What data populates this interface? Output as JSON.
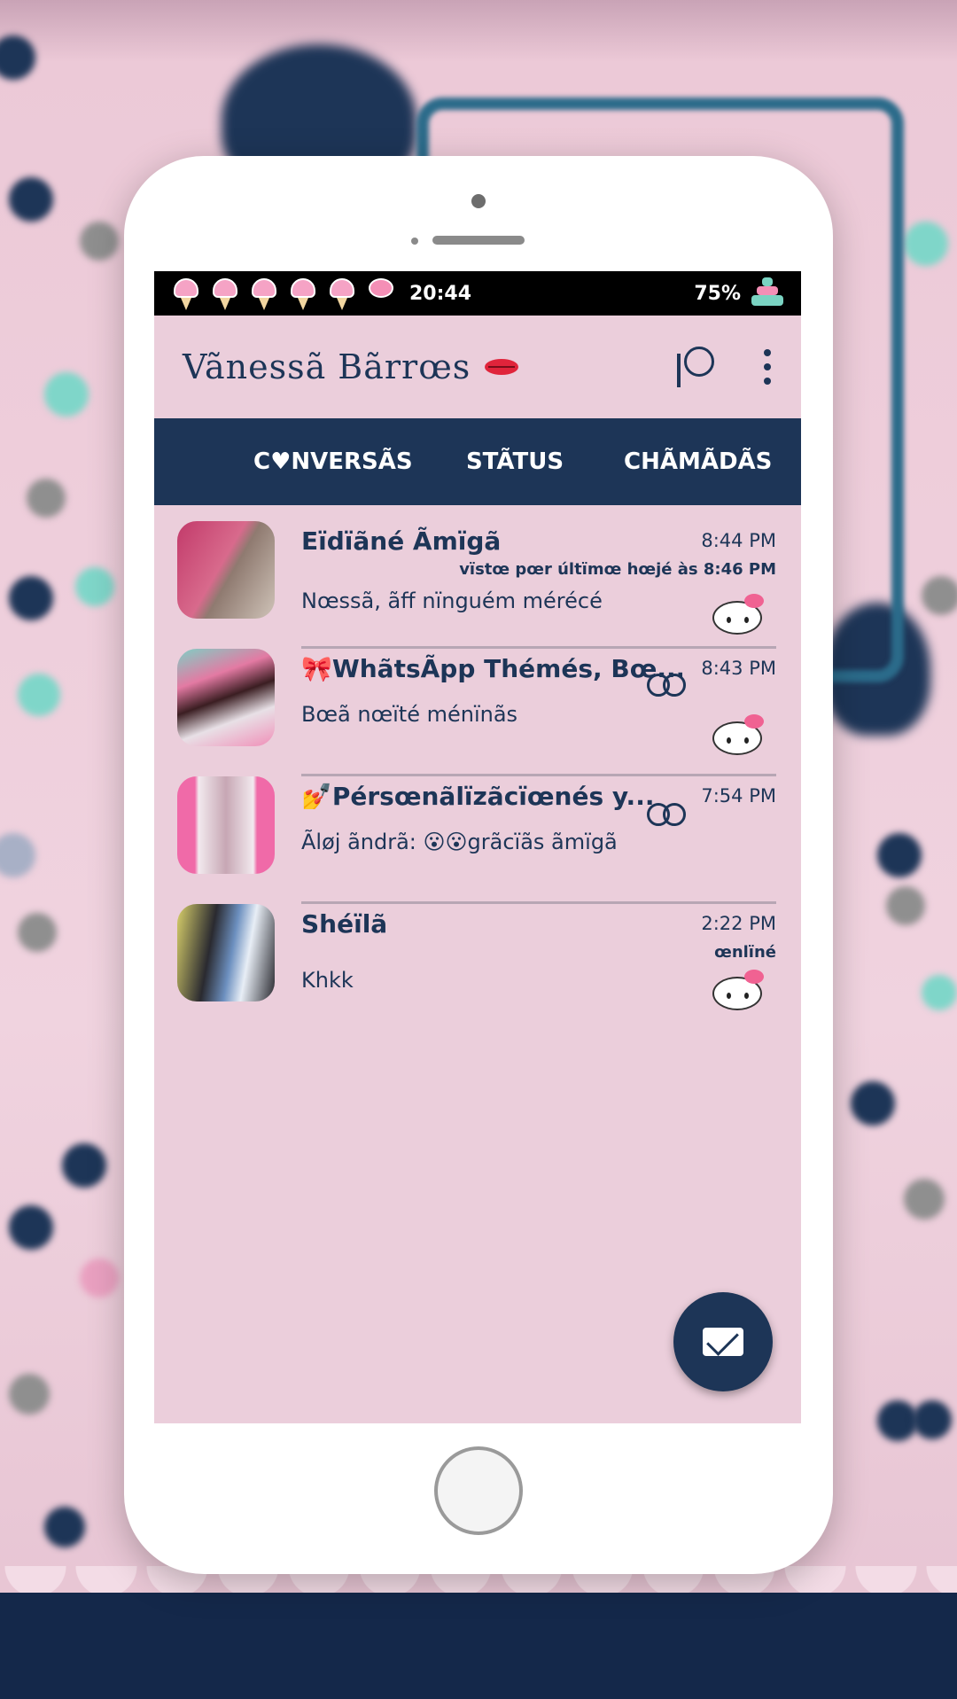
{
  "status_bar": {
    "time": "20:44",
    "battery": "75%"
  },
  "app_bar": {
    "title": "Vãnessã Bãrrœs"
  },
  "tabs": [
    {
      "label": "C♥NVERSÃS"
    },
    {
      "label": "STÃTUS"
    },
    {
      "label": "CHÃMÃDÃS"
    }
  ],
  "chats": [
    {
      "name": "Eïdïãné Ãmïgã",
      "time": "8:44 PM",
      "subtitle": "vïstœ pœr últïmœ hœjé às 8:46 PM",
      "message": "Nœssã, ãff nïnguém mérécé"
    },
    {
      "name": "🎀WhãtsÃpp Thémés, Bœ...",
      "time": "8:43 PM",
      "subtitle": "",
      "message": "Bœã nœïté ménïnãs"
    },
    {
      "name": "💅Pérsœnãlïzãcïœnés y...",
      "time": "7:54 PM",
      "subtitle": "",
      "message": "Ãløj ãndrã: 😮😮grãcïãs ãmïgã"
    },
    {
      "name": "Shéïlã",
      "time": "2:22 PM",
      "subtitle": "œnlïné",
      "message": "Khkk"
    }
  ]
}
